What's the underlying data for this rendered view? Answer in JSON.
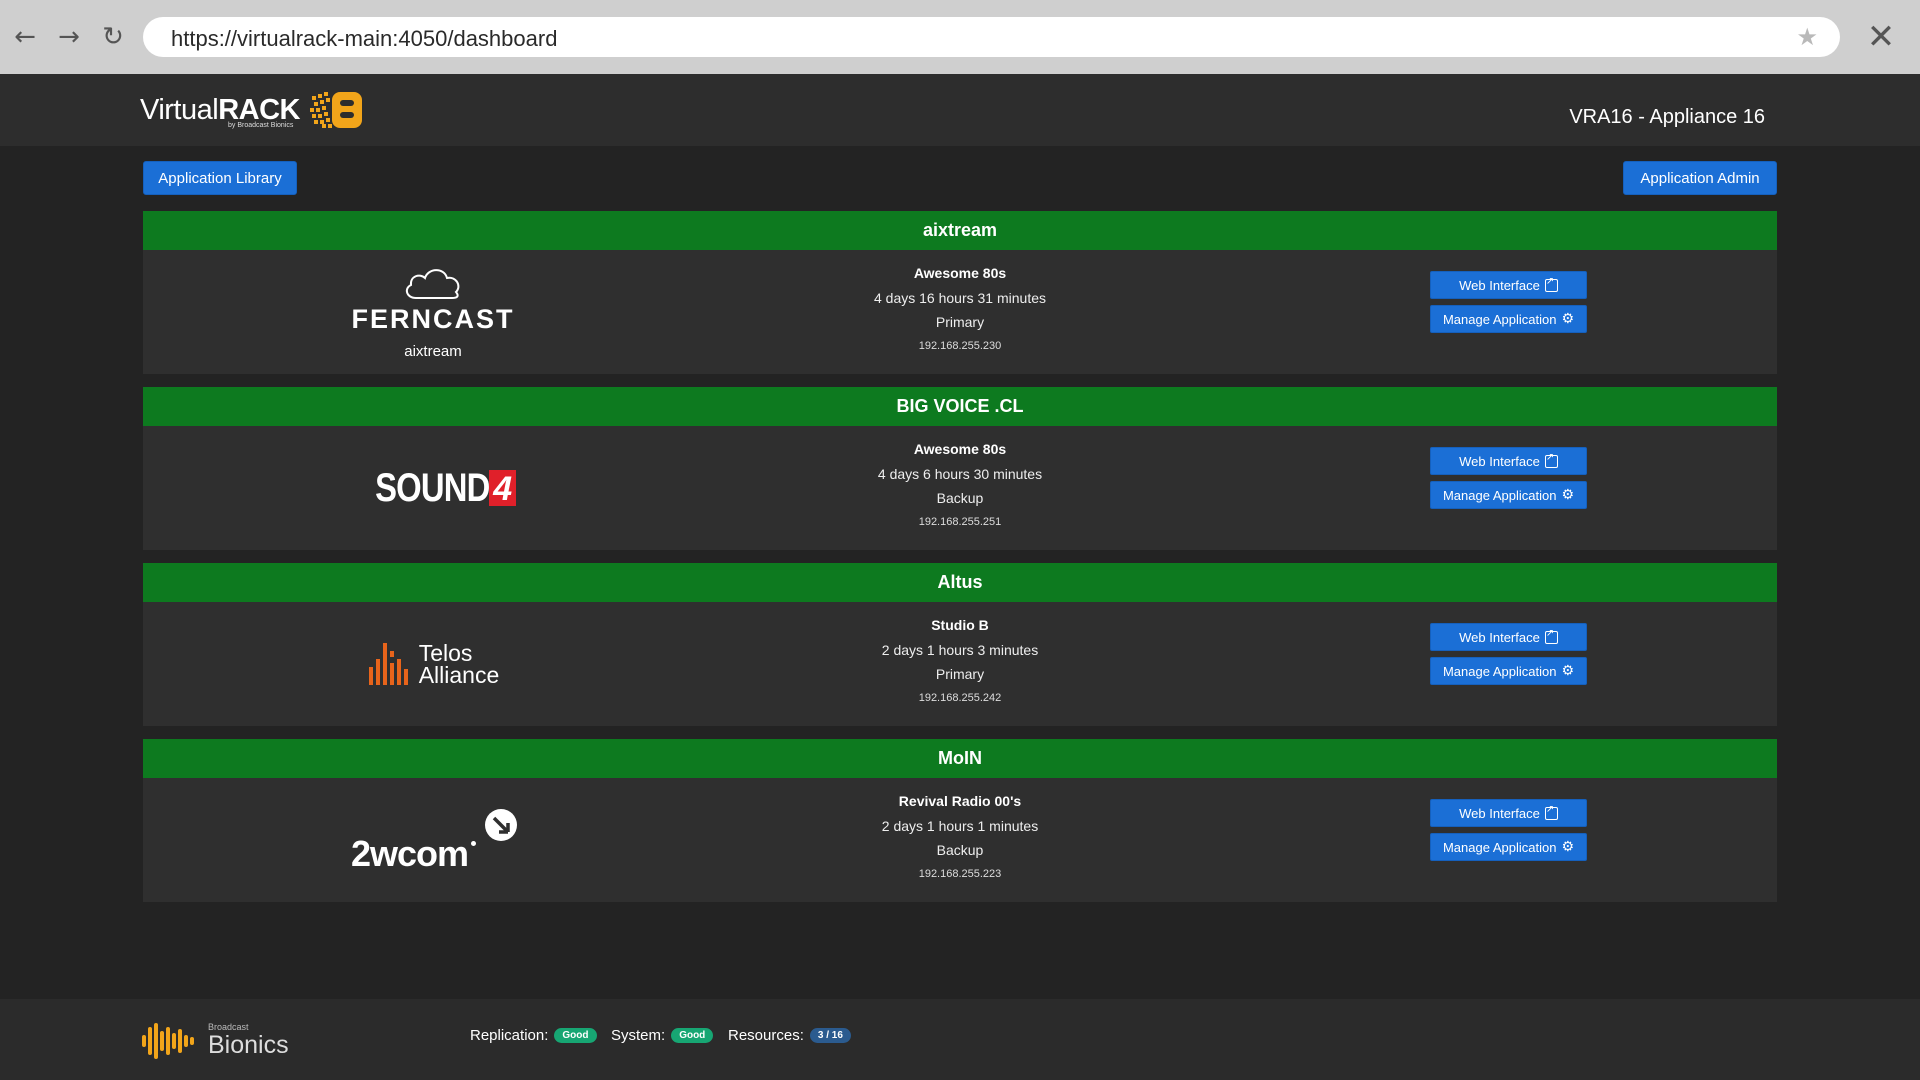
{
  "browser": {
    "url": "https://virtualrack-main:4050/dashboard"
  },
  "header": {
    "brand_light": "Virtual",
    "brand_bold": "RACK",
    "brand_sub": "by Broadcast Bionics",
    "appliance": "VRA16 - Appliance 16"
  },
  "toolbar": {
    "library_label": "Application Library",
    "admin_label": "Application Admin"
  },
  "apps": [
    {
      "title": "aixtream",
      "logo_text": "FERNCAST",
      "logo_caption": "aixtream",
      "name": "Awesome 80s",
      "uptime": "4 days 16 hours 31 minutes",
      "role": "Primary",
      "ip": "192.168.255.230",
      "web_label": "Web Interface",
      "manage_label": "Manage Application"
    },
    {
      "title": "BIG VOICE .CL",
      "logo_text": "SOUND",
      "logo_caption": "4",
      "name": "Awesome 80s",
      "uptime": "4 days 6 hours 30 minutes",
      "role": "Backup",
      "ip": "192.168.255.251",
      "web_label": "Web Interface",
      "manage_label": "Manage Application"
    },
    {
      "title": "Altus",
      "logo_text": "Telos",
      "logo_caption": "Alliance",
      "name": "Studio B",
      "uptime": "2 days 1 hours 3 minutes",
      "role": "Primary",
      "ip": "192.168.255.242",
      "web_label": "Web Interface",
      "manage_label": "Manage Application"
    },
    {
      "title": "MoIN",
      "logo_text": "2wcom",
      "logo_caption": "",
      "name": "Revival Radio 00's",
      "uptime": "2 days 1 hours 1 minutes",
      "role": "Backup",
      "ip": "192.168.255.223",
      "web_label": "Web Interface",
      "manage_label": "Manage Application"
    }
  ],
  "footer": {
    "brand_small": "Broadcast",
    "brand_big": "Bionics",
    "replication_label": "Replication:",
    "replication_value": "Good",
    "system_label": "System:",
    "system_value": "Good",
    "resources_label": "Resources:",
    "resources_value": "3 / 16"
  },
  "colors": {
    "card_header": "#0d7a1f",
    "button": "#1b6fd6",
    "status_good": "#17a673",
    "brand_accent": "#f2a51a",
    "sound4_red": "#e0202a",
    "telos_orange": "#e8641b"
  }
}
